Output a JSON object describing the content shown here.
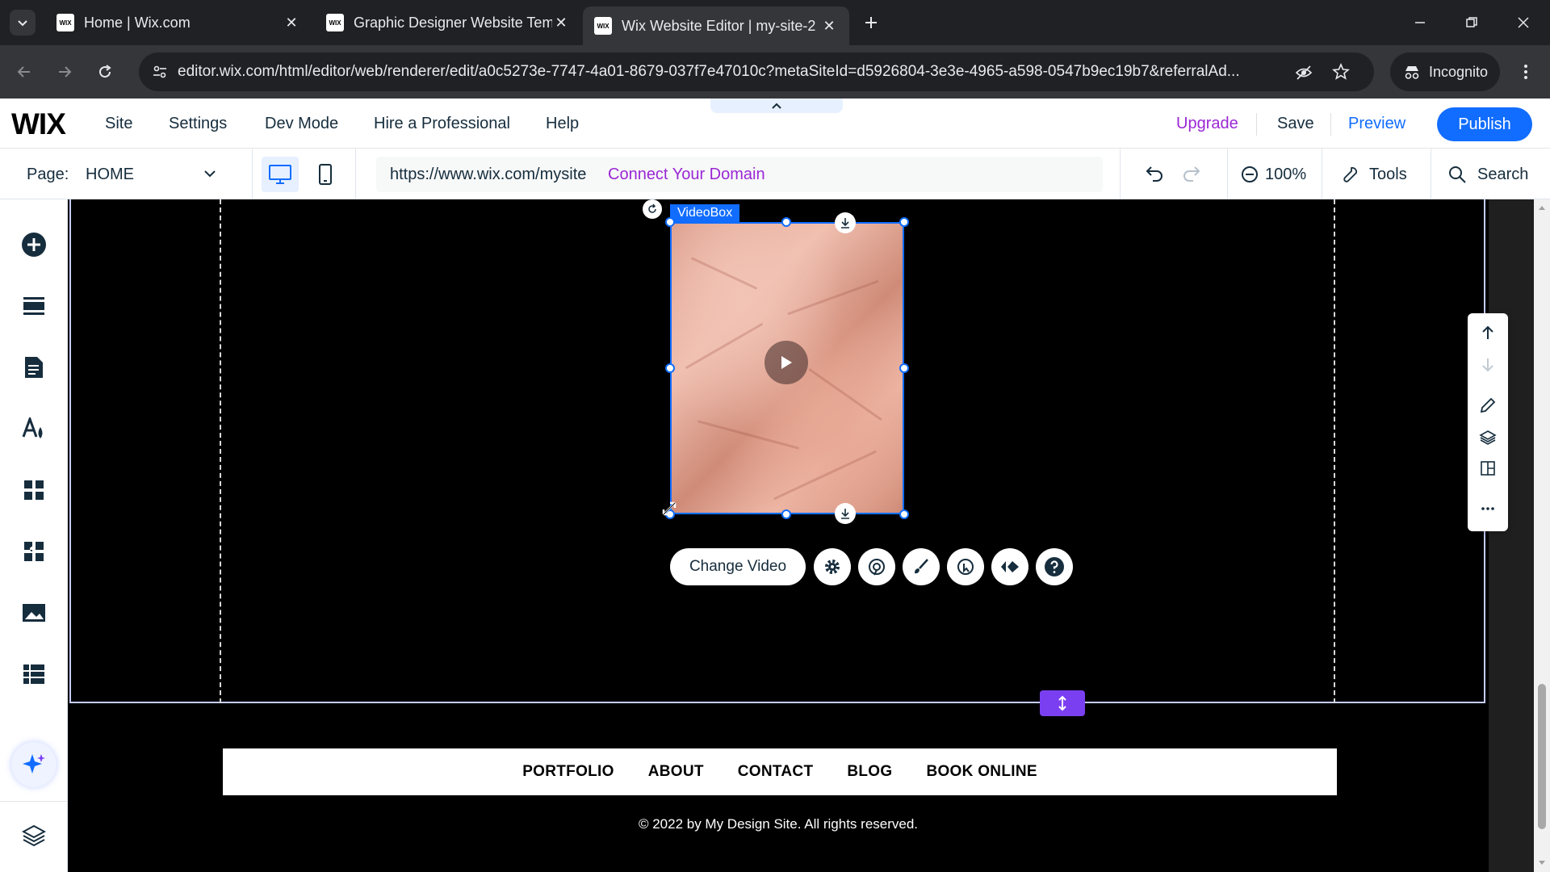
{
  "browser": {
    "tabs": [
      {
        "title": "Home | Wix.com",
        "favicon": "WIX",
        "active": false
      },
      {
        "title": "Graphic Designer Website Temp",
        "favicon": "WIX",
        "active": false
      },
      {
        "title": "Wix Website Editor | my-site-2",
        "favicon": "WIX",
        "active": true
      }
    ],
    "url": "editor.wix.com/html/editor/web/renderer/edit/a0c5273e-7747-4a01-8679-037f7e47010c?metaSiteId=d5926804-3e3e-4965-a598-0547b9ec19b7&referralAd...",
    "incognito_label": "Incognito"
  },
  "wix_topbar": {
    "logo": "WIX",
    "menu": [
      "Site",
      "Settings",
      "Dev Mode",
      "Hire a Professional",
      "Help"
    ],
    "upgrade": "Upgrade",
    "save": "Save",
    "preview": "Preview",
    "publish": "Publish",
    "accent": "#116dff",
    "upgrade_color": "#9a27d5"
  },
  "page_bar": {
    "page_label": "Page:",
    "page_value": "HOME",
    "site_url": "https://www.wix.com/mysite",
    "connect_domain": "Connect Your Domain",
    "zoom": "100%",
    "tools": "Tools",
    "search": "Search"
  },
  "left_panel": {
    "icons": [
      "add-elements-icon",
      "sections-icon",
      "pages-icon",
      "site-design-icon",
      "add-apps-icon",
      "business-apps-icon",
      "media-icon",
      "cms-icon",
      "ai-assistant-icon",
      "layers-icon"
    ]
  },
  "canvas": {
    "videobox_label": "VideoBox",
    "change_video": "Change Video",
    "toolbar_icons": [
      "settings-icon",
      "animation-icon",
      "design-icon",
      "behavior-icon",
      "interactions-icon",
      "help-icon"
    ],
    "footer_nav": [
      "PORTFOLIO",
      "ABOUT",
      "CONTACT",
      "BLOG",
      "BOOK ONLINE"
    ],
    "copyright": "© 2022 by My Design Site. All rights reserved."
  }
}
